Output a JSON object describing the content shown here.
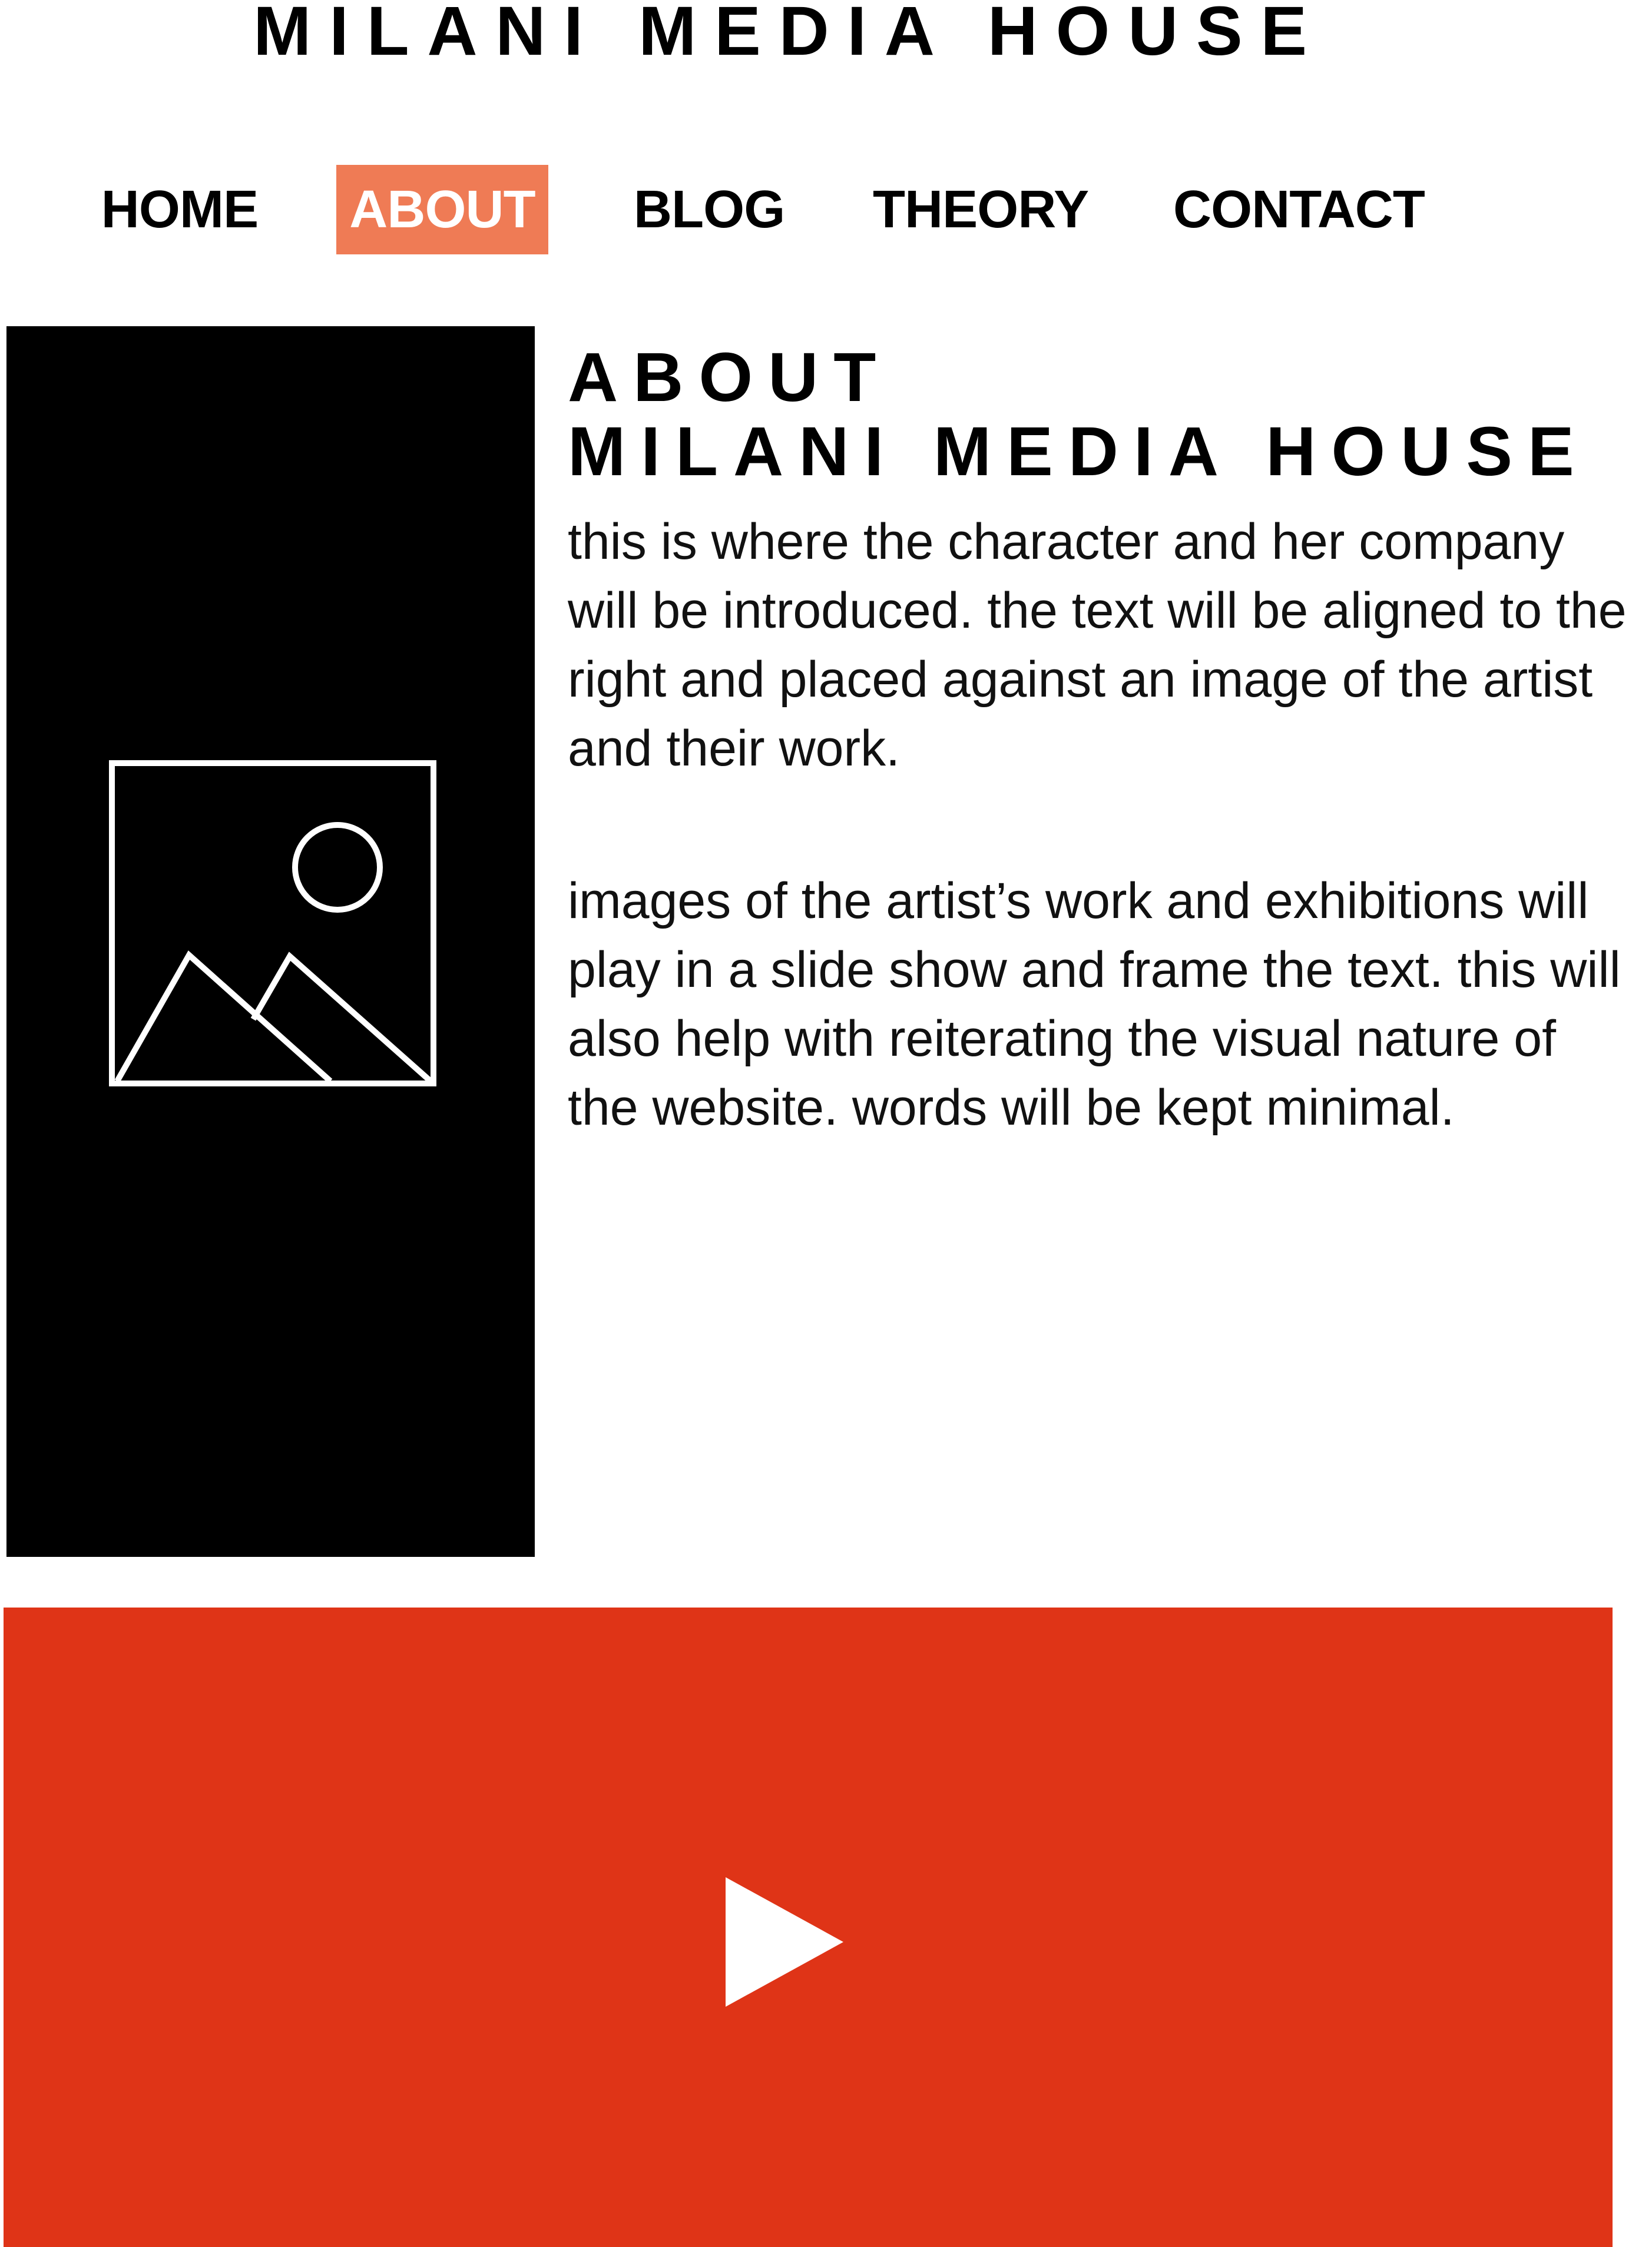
{
  "site": {
    "title": "MILANI MEDIA HOUSE"
  },
  "nav": {
    "items": [
      {
        "label": "HOME",
        "active": false
      },
      {
        "label": "ABOUT",
        "active": true
      },
      {
        "label": "BLOG",
        "active": false
      },
      {
        "label": "THEORY",
        "active": false
      },
      {
        "label": "CONTACT",
        "active": false
      }
    ],
    "active_color": "#ef7b55"
  },
  "image_panel": {
    "icon": "image-placeholder-icon",
    "background_color": "#000000"
  },
  "about": {
    "heading_line1": "ABOUT",
    "heading_line2": "MILANI MEDIA HOUSE",
    "paragraph1": "this is where the character and her company will be introduced. the text will be aligned to the right and placed against an image of the artist and their work.",
    "paragraph2": "images of the artist’s work and exhibitions will play in a slide show and frame the text. this will also help with reiterating the visual nature of the website. words will be kept minimal."
  },
  "video": {
    "icon": "play-icon",
    "background_color": "#df3417"
  }
}
